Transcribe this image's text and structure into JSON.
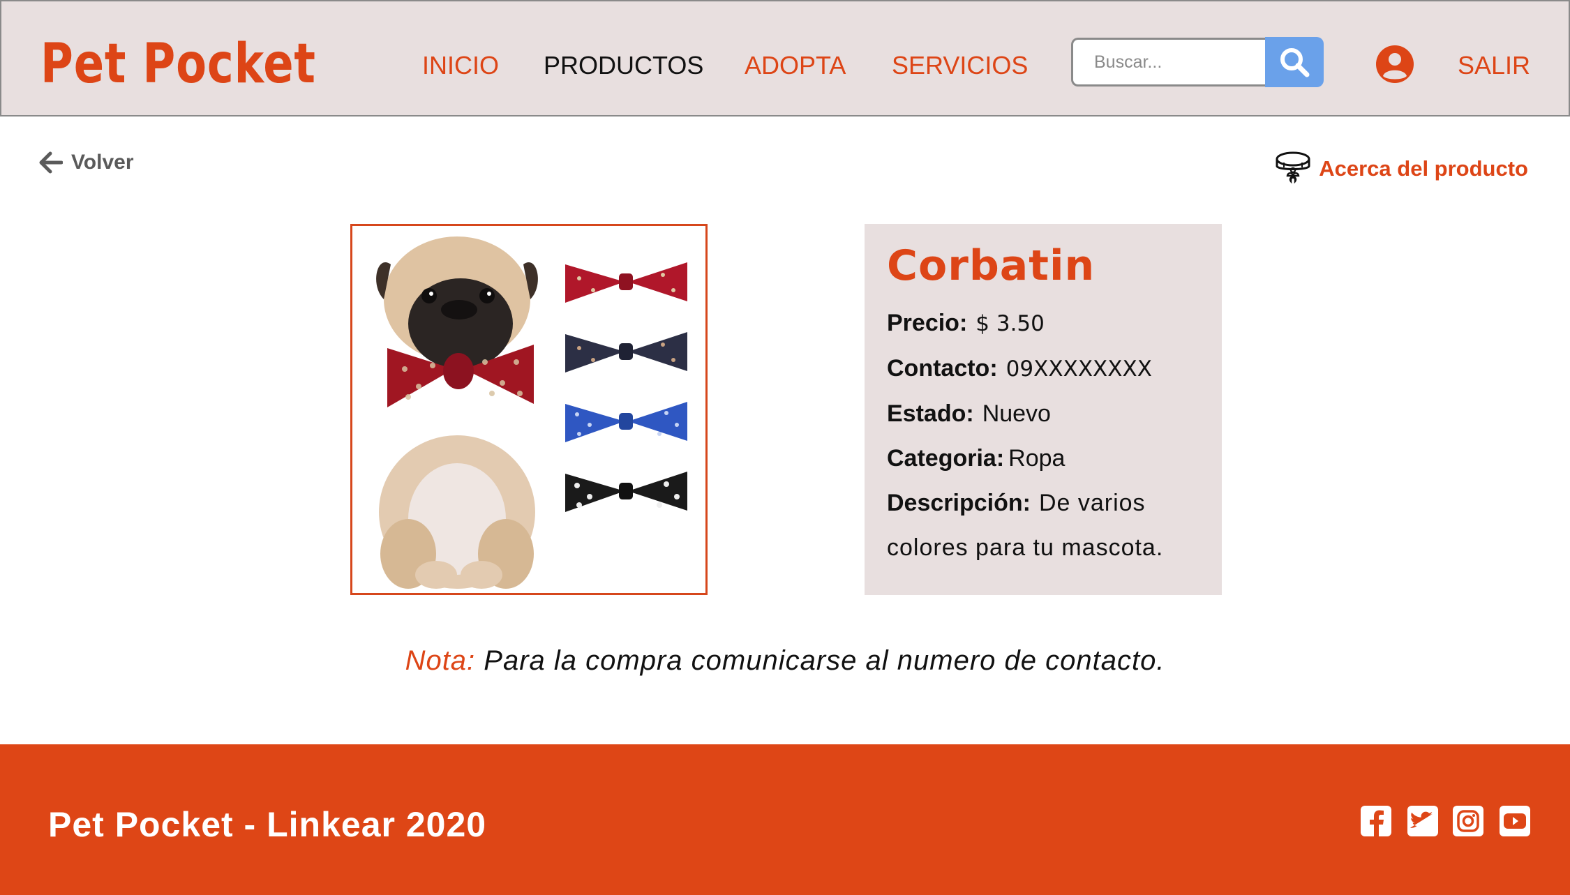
{
  "header": {
    "logo": "Pet Pocket",
    "nav": [
      "INICIO",
      "PRODUCTOS",
      "ADOPTA",
      "SERVICIOS"
    ],
    "search": {
      "placeholder": "Buscar..."
    },
    "logout": "SALIR"
  },
  "subbar": {
    "back_label": "Volver",
    "about_label": "Acerca del producto"
  },
  "product": {
    "name": "Corbatin",
    "price_label": "Precio:",
    "price": "$ 3.50",
    "contact_label": "Contacto:",
    "contact": "09XXXXXXXX",
    "state_label": "Estado:",
    "state": "Nuevo",
    "category_label": "Categoria:",
    "category": "Ropa",
    "description_label": "Descripción:",
    "description": "De varios colores para tu mascota."
  },
  "note": {
    "label": "Nota:",
    "text": "Para la compra comunicarse al numero de contacto."
  },
  "footer": {
    "text": "Pet Pocket - Linkear 2020",
    "social": [
      "facebook-icon",
      "twitter-icon",
      "instagram-icon",
      "youtube-icon"
    ]
  },
  "colors": {
    "brand": "#dd4516",
    "header_bg": "#e8dfdf",
    "search_button": "#6aa1ea",
    "footer_bg": "#de4616"
  }
}
